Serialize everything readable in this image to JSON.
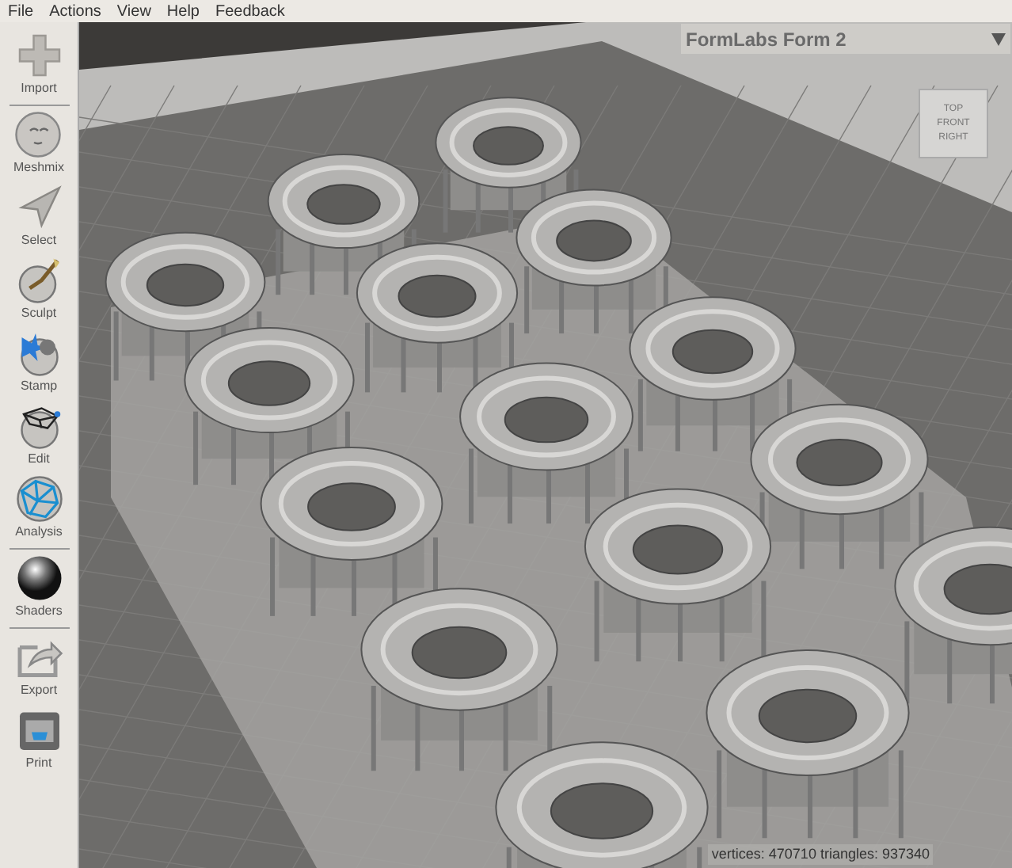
{
  "menu": [
    "File",
    "Actions",
    "View",
    "Help",
    "Feedback"
  ],
  "toolbar": [
    {
      "label": "Import",
      "separator_after": true
    },
    {
      "label": "Meshmix",
      "separator_after": false
    },
    {
      "label": "Select",
      "separator_after": false
    },
    {
      "label": "Sculpt",
      "separator_after": false
    },
    {
      "label": "Stamp",
      "separator_after": false
    },
    {
      "label": "Edit",
      "separator_after": false
    },
    {
      "label": "Analysis",
      "separator_after": true
    },
    {
      "label": "Shaders",
      "separator_after": true
    },
    {
      "label": "Export",
      "separator_after": false
    },
    {
      "label": "Print",
      "separator_after": false
    }
  ],
  "printer_dropdown": {
    "value": "FormLabs Form 2"
  },
  "view_cube": {
    "faces": [
      "TOP",
      "FRONT",
      "RIGHT"
    ]
  },
  "status": "vertices: 470710 triangles: 937340"
}
